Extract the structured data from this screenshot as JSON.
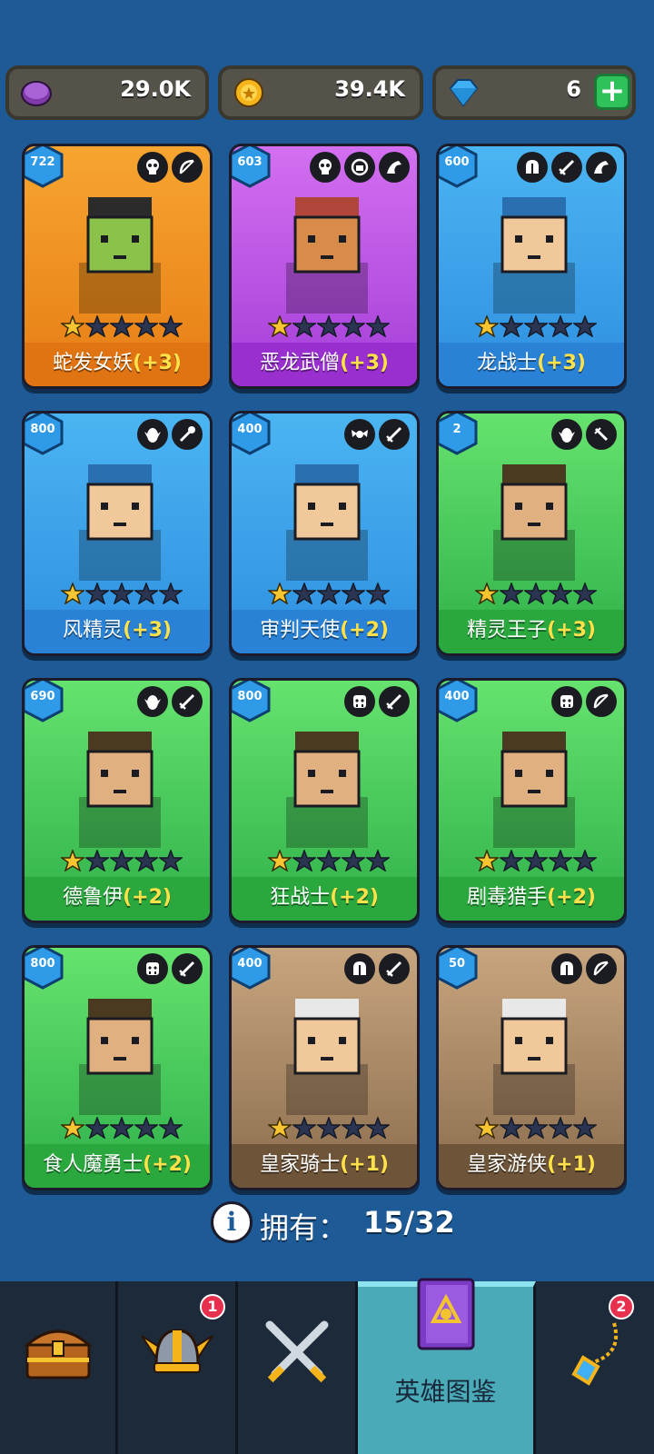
{
  "currencies": [
    {
      "name": "purple-token",
      "value": "29.0K"
    },
    {
      "name": "gold-coin",
      "value": "39.4K"
    },
    {
      "name": "diamond",
      "value": "6"
    }
  ],
  "heroes": [
    {
      "level": "722",
      "name": "蛇发女妖",
      "bonus": "(+3)",
      "stars": 1,
      "color": "orange",
      "tags": [
        "skull-icon",
        "bow-icon"
      ]
    },
    {
      "level": "603",
      "name": "恶龙武僧",
      "bonus": "(+3)",
      "stars": 1,
      "color": "purple",
      "tags": [
        "skull-icon",
        "fist-icon",
        "dragon-icon"
      ]
    },
    {
      "level": "600",
      "name": "龙战士",
      "bonus": "(+3)",
      "stars": 1,
      "color": "blue",
      "tags": [
        "helmet-icon",
        "sword-icon",
        "dragon-icon"
      ]
    },
    {
      "level": "800",
      "name": "风精灵",
      "bonus": "(+3)",
      "stars": 1,
      "color": "blue",
      "tags": [
        "elf-icon",
        "staff-icon"
      ]
    },
    {
      "level": "400",
      "name": "审判天使",
      "bonus": "(+2)",
      "stars": 1,
      "color": "blue",
      "tags": [
        "angel-icon",
        "sword-icon"
      ]
    },
    {
      "level": "2",
      "name": "精灵王子",
      "bonus": "(+3)",
      "stars": 1,
      "color": "green",
      "tags": [
        "elf-icon",
        "dagger-icon"
      ]
    },
    {
      "level": "690",
      "name": "德鲁伊",
      "bonus": "(+2)",
      "stars": 1,
      "color": "green",
      "tags": [
        "elf-icon",
        "sword-icon"
      ]
    },
    {
      "level": "800",
      "name": "狂战士",
      "bonus": "(+2)",
      "stars": 1,
      "color": "green",
      "tags": [
        "orc-icon",
        "sword-icon"
      ]
    },
    {
      "level": "400",
      "name": "剧毒猎手",
      "bonus": "(+2)",
      "stars": 1,
      "color": "green",
      "tags": [
        "orc-icon",
        "bow-icon"
      ]
    },
    {
      "level": "800",
      "name": "食人魔勇士",
      "bonus": "(+2)",
      "stars": 1,
      "color": "green",
      "tags": [
        "orc-icon",
        "sword-icon"
      ]
    },
    {
      "level": "400",
      "name": "皇家骑士",
      "bonus": "(+1)",
      "stars": 1,
      "color": "brown",
      "tags": [
        "helmet-icon",
        "sword-icon"
      ]
    },
    {
      "level": "50",
      "name": "皇家游侠",
      "bonus": "(+1)",
      "stars": 1,
      "color": "brown",
      "tags": [
        "helmet-icon",
        "bow-icon"
      ]
    }
  ],
  "owned": {
    "label": "拥有：",
    "count": "15/32"
  },
  "nav": [
    {
      "name": "chest",
      "label": "",
      "badge": ""
    },
    {
      "name": "hero",
      "label": "",
      "badge": "1"
    },
    {
      "name": "battle",
      "label": "",
      "badge": ""
    },
    {
      "name": "codex",
      "label": "英雄图鉴",
      "badge": ""
    },
    {
      "name": "amulet",
      "label": "",
      "badge": "2"
    }
  ]
}
